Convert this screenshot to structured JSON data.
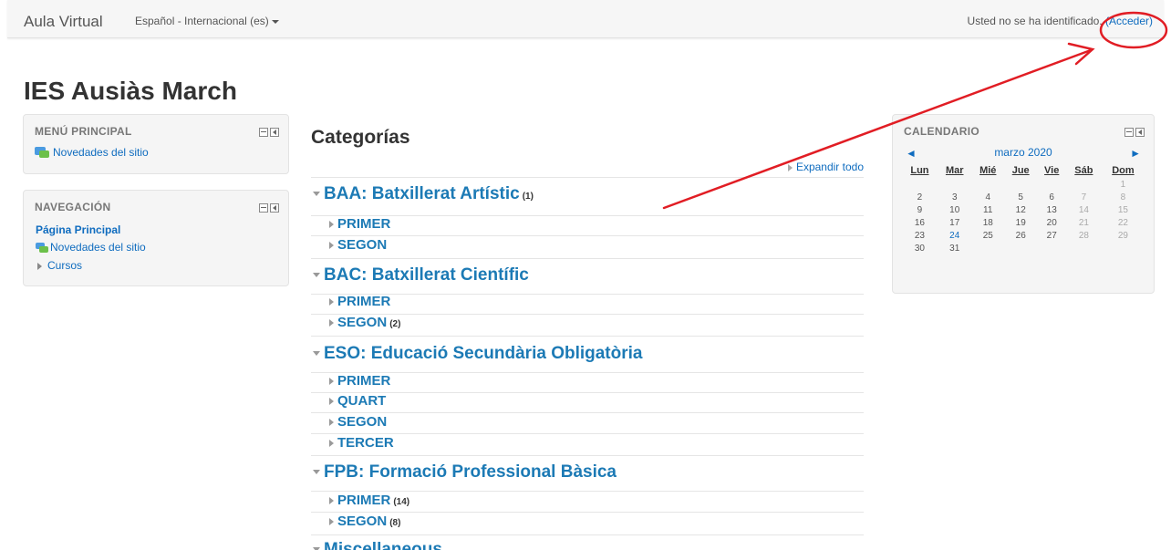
{
  "topbar": {
    "brand": "Aula Virtual",
    "language": "Español - Internacional (es)",
    "login_text": "Usted no se ha identificado. ",
    "login_link": "(Acceder)"
  },
  "site": {
    "title": "IES Ausiàs March"
  },
  "main_menu": {
    "title": "MENÚ PRINCIPAL",
    "items": [
      {
        "label": "Novedades del sitio",
        "icon": "forum-icon"
      }
    ]
  },
  "navigation": {
    "title": "NAVEGACIÓN",
    "items": [
      {
        "label": "Página Principal"
      },
      {
        "label": "Novedades del sitio",
        "icon": "forum-icon"
      },
      {
        "label": "Cursos",
        "icon": "triangle-right-icon"
      }
    ]
  },
  "categories": {
    "heading": "Categorías",
    "expand_all": "Expandir todo",
    "items": [
      {
        "name": "BAA: Batxillerat Artístic",
        "count": "(1)",
        "subcategories": [
          {
            "name": "PRIMER",
            "count": ""
          },
          {
            "name": "SEGON",
            "count": ""
          }
        ]
      },
      {
        "name": "BAC: Batxillerat Científic",
        "count": "",
        "subcategories": [
          {
            "name": "PRIMER",
            "count": ""
          },
          {
            "name": "SEGON",
            "count": "(2)"
          }
        ]
      },
      {
        "name": "ESO: Educació Secundària Obligatòria",
        "count": "",
        "subcategories": [
          {
            "name": "PRIMER",
            "count": ""
          },
          {
            "name": "QUART",
            "count": ""
          },
          {
            "name": "SEGON",
            "count": ""
          },
          {
            "name": "TERCER",
            "count": ""
          }
        ]
      },
      {
        "name": "FPB: Formació Professional Bàsica",
        "count": "",
        "subcategories": [
          {
            "name": "PRIMER",
            "count": "(14)"
          },
          {
            "name": "SEGON",
            "count": "(8)"
          }
        ]
      },
      {
        "name": "Miscellaneous",
        "count": "",
        "subcategories": []
      }
    ]
  },
  "calendar": {
    "title": "CALENDARIO",
    "prev": "◄",
    "next": "►",
    "month": "marzo 2020",
    "weekdays": [
      "Lun",
      "Mar",
      "Mié",
      "Jue",
      "Vie",
      "Sáb",
      "Dom"
    ],
    "weeks": [
      [
        "",
        "",
        "",
        "",
        "",
        "",
        "1"
      ],
      [
        "2",
        "3",
        "4",
        "5",
        "6",
        "7",
        "8"
      ],
      [
        "9",
        "10",
        "11",
        "12",
        "13",
        "14",
        "15"
      ],
      [
        "16",
        "17",
        "18",
        "19",
        "20",
        "21",
        "22"
      ],
      [
        "23",
        "24",
        "25",
        "26",
        "27",
        "28",
        "29"
      ],
      [
        "30",
        "31",
        "",
        "",
        "",
        "",
        ""
      ]
    ],
    "today": "24"
  },
  "colors": {
    "link": "#0f6cbf",
    "category": "#1c7ab5",
    "annotation": "#e11d24"
  }
}
